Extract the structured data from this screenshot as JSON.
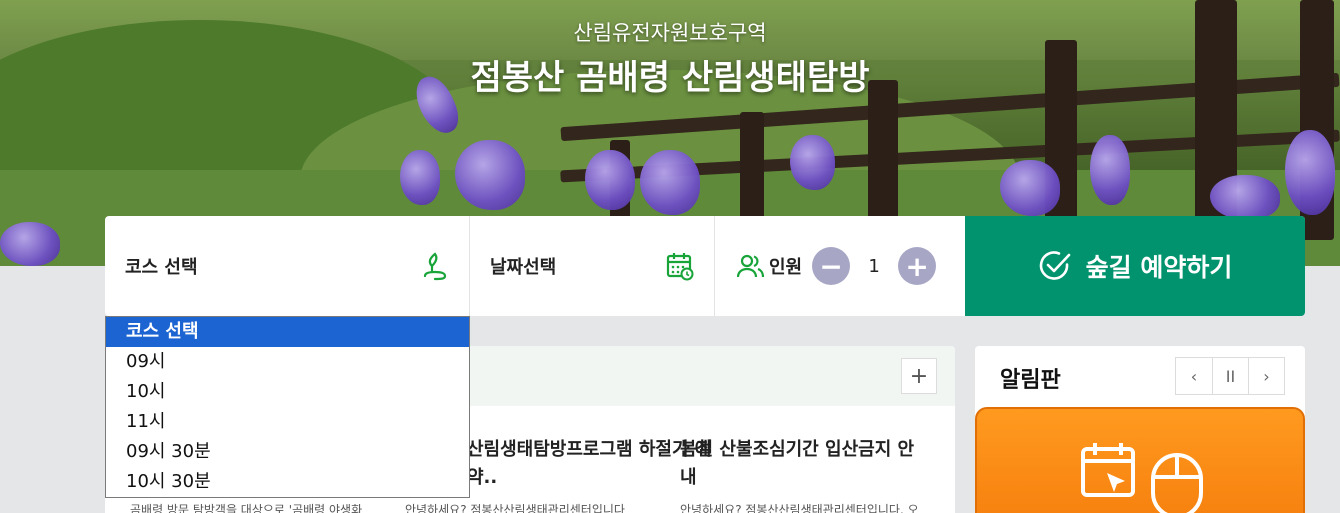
{
  "hero": {
    "subtitle": "산림유전자원보호구역",
    "title": "점봉산 곰배령 산림생태탐방"
  },
  "booking": {
    "course_label": "코스 선택",
    "date_label": "날짜선택",
    "people_label": "인원",
    "people_count": "1",
    "minus_symbol": "−",
    "plus_symbol": "+",
    "reserve_label": "숲길 예약하기",
    "accent_color": "#00936e"
  },
  "course_dropdown": {
    "options": [
      "코스 선택",
      "09시",
      "10시",
      "11시",
      "09시 30분",
      "10시 30분"
    ],
    "selected": "코스 선택"
  },
  "news": {
    "more_symbol": "+",
    "cards": [
      {
        "title": "산림생태탐방프로그램 하절기 예약..",
        "body": "안녕하세요? 점봉산산림생태관리센터입니다"
      },
      {
        "title": "봄철 산불조심기간 입산금지 안내",
        "body": "안녕하세요? 점봉산산림생태관리센터입니다. 오"
      }
    ],
    "first_body": "곰배령 방문 탐방객을 대상으로 '곰배령 야생화"
  },
  "notice": {
    "title": "알림판",
    "prev_symbol": "‹",
    "pause_symbol": "II",
    "next_symbol": "›"
  }
}
